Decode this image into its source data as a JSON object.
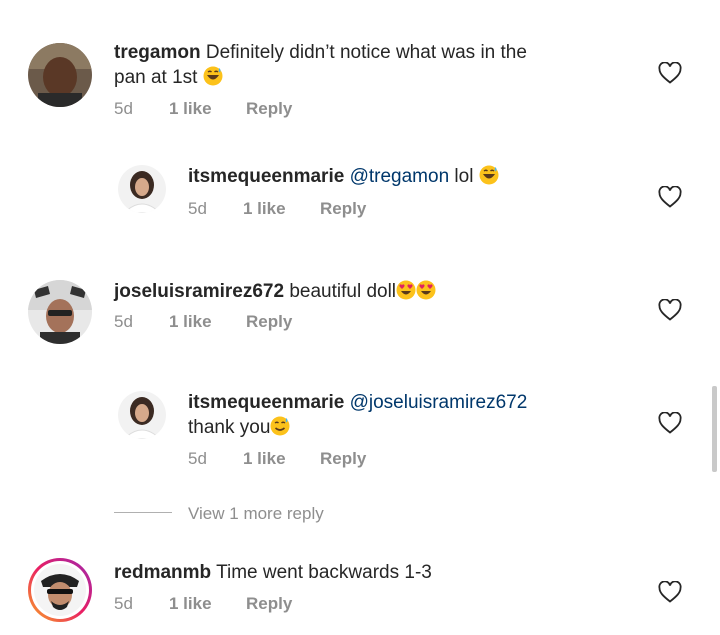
{
  "comments": [
    {
      "username": "tregamon",
      "text": "Definitely didn’t notice what was in the pan at 1st",
      "age": "5d",
      "likes": "1 like",
      "reply_label": "Reply",
      "emoji": "grinning-sweat"
    },
    {
      "username": "itsmequeenmarie",
      "mention": "@tregamon",
      "text": "lol",
      "age": "5d",
      "likes": "1 like",
      "reply_label": "Reply",
      "emoji": "grinning-sweat"
    },
    {
      "username": "joseluisramirez672",
      "text": "beautiful doll",
      "age": "5d",
      "likes": "1 like",
      "reply_label": "Reply",
      "emoji": "heart-eyes-x2"
    },
    {
      "username": "itsmequeenmarie",
      "mention": "@joseluisramirez672",
      "text": "thank you",
      "age": "5d",
      "likes": "1 like",
      "reply_label": "Reply",
      "emoji": "smiling-sweat"
    },
    {
      "username": "redmanmb",
      "text": "Time went backwards 1-3",
      "age": "5d",
      "likes": "1 like",
      "reply_label": "Reply"
    }
  ],
  "view_more_replies": "View 1 more reply",
  "icons": {
    "like": "heart-outline-icon"
  },
  "colors": {
    "mention": "#00376b",
    "meta": "#8e8e8e",
    "text": "#262626"
  }
}
